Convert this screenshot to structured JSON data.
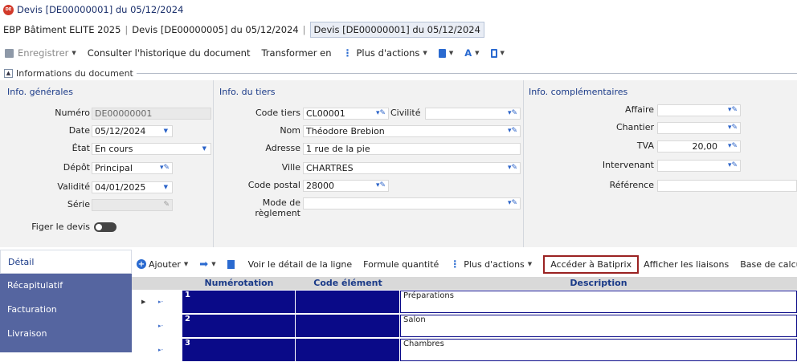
{
  "window": {
    "title": "Devis [DE00000001] du 05/12/2024",
    "app_badge": "DE"
  },
  "tabs": [
    {
      "label": "EBP Bâtiment ELITE 2025"
    },
    {
      "label": "Devis [DE00000005] du 05/12/2024"
    },
    {
      "label": "Devis [DE00000001] du 05/12/2024"
    }
  ],
  "toolbar": {
    "save": "Enregistrer",
    "history": "Consulter l'historique du document",
    "transform": "Transformer en",
    "more": "Plus d'actions"
  },
  "panel": {
    "title": "Informations du document"
  },
  "general": {
    "section": "Info. générales",
    "numero_label": "Numéro",
    "numero": "DE00000001",
    "date_label": "Date",
    "date": "05/12/2024",
    "etat_label": "État",
    "etat": "En cours",
    "depot_label": "Dépôt",
    "depot": "Principal",
    "validite_label": "Validité",
    "validite": "04/01/2025",
    "serie_label": "Série",
    "serie": "",
    "figer_label": "Figer le devis"
  },
  "tiers": {
    "section": "Info. du tiers",
    "code_label": "Code tiers",
    "code": "CL00001",
    "civilite_label": "Civilité",
    "civilite": "",
    "nom_label": "Nom",
    "nom": "Théodore Brebion",
    "adresse_label": "Adresse",
    "adresse": "1 rue de la pie",
    "ville_label": "Ville",
    "ville": "CHARTRES",
    "cp_label": "Code postal",
    "cp": "28000",
    "reglement_label": "Mode de règlement",
    "reglement": ""
  },
  "complement": {
    "section": "Info. complémentaires",
    "affaire_label": "Affaire",
    "affaire": "",
    "chantier_label": "Chantier",
    "chantier": "",
    "tva_label": "TVA",
    "tva": "20,00",
    "intervenant_label": "Intervenant",
    "intervenant": "",
    "reference_label": "Référence",
    "reference": ""
  },
  "sidebar": {
    "items": [
      "Détail",
      "Récapitulatif",
      "Facturation",
      "Livraison"
    ]
  },
  "grid_toolbar": {
    "add": "Ajouter",
    "detail": "Voir le détail de la ligne",
    "formula": "Formule quantité",
    "more": "Plus d'actions",
    "batiprix": "Accéder à Batiprix",
    "links": "Afficher les liaisons",
    "ttc": "Base de calcul TTC"
  },
  "grid": {
    "columns": [
      "Numérotation",
      "Code élément",
      "Description"
    ],
    "rows": [
      {
        "num": "1",
        "code": "",
        "desc": "Préparations"
      },
      {
        "num": "2",
        "code": "",
        "desc": "Salon"
      },
      {
        "num": "3",
        "code": "",
        "desc": "Chambres"
      }
    ]
  },
  "colors": {
    "accent": "#2a6ad0",
    "sidebar": "#5565a0",
    "row_fill": "#0a0a88",
    "highlight": "#9a2222"
  }
}
